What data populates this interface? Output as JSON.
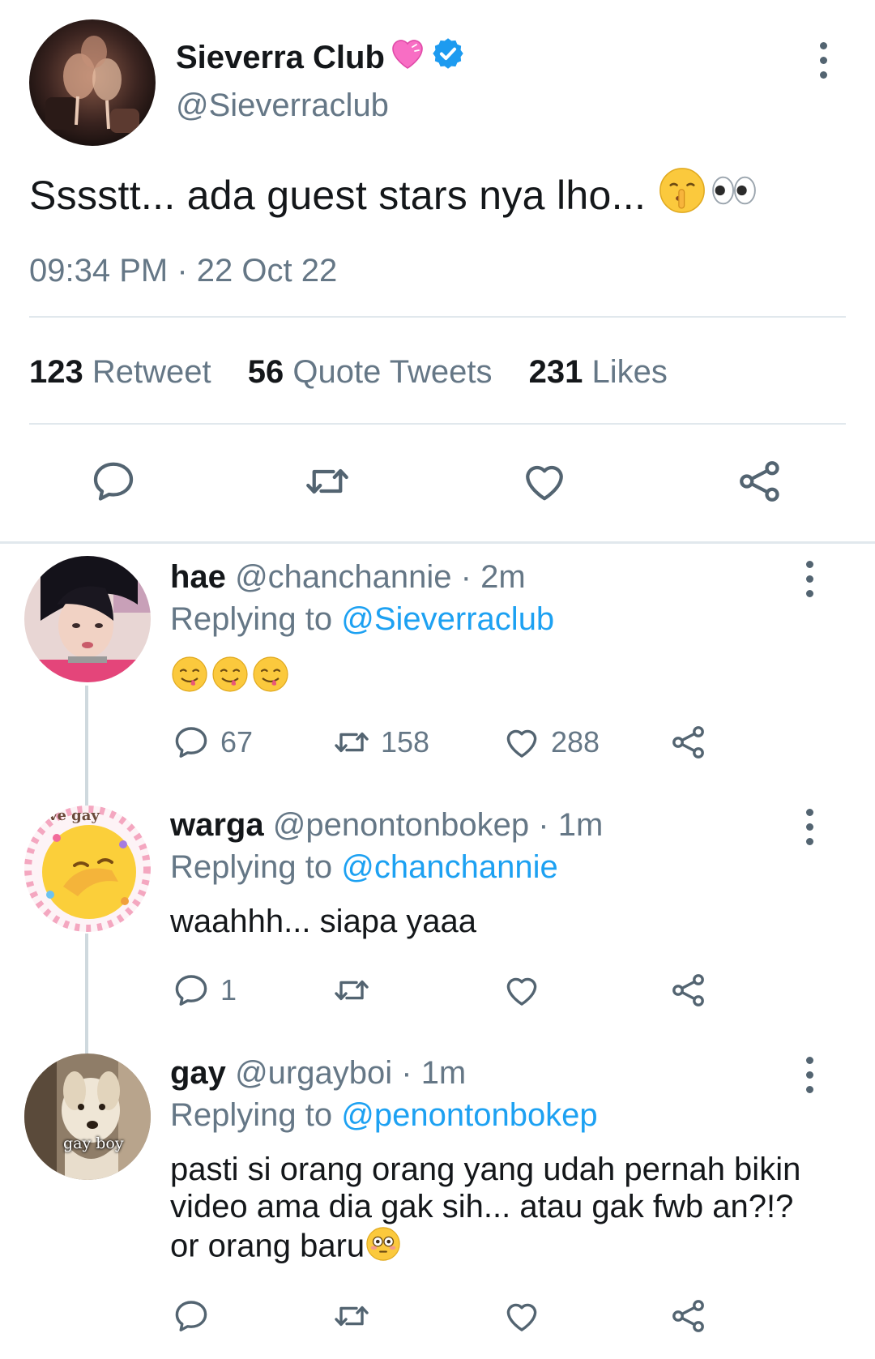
{
  "main_tweet": {
    "name": "Sieverra Club",
    "handle": "@Sieverraclub",
    "text": "Sssstt... ada guest stars nya lho...",
    "time": "09:34 PM",
    "date_sep": "·",
    "date": "22 Oct 22",
    "stats": [
      {
        "count": "123",
        "label": "Retweet"
      },
      {
        "count": "56",
        "label": "Quote Tweets"
      },
      {
        "count": "231",
        "label": "Likes"
      }
    ],
    "actions": [
      "reply-icon",
      "retweet-icon",
      "like-icon",
      "share-icon"
    ]
  },
  "replies": [
    {
      "name": "hae",
      "handle": "@chanchannie",
      "sep": "·",
      "time": "2m",
      "replying_label": "Replying to",
      "replying_to": "@Sieverraclub",
      "text": "",
      "counts": {
        "reply": "67",
        "retweet": "158",
        "like": "288"
      }
    },
    {
      "name": "warga",
      "handle": "@penontonbokep",
      "sep": "·",
      "time": "1m",
      "replying_label": "Replying to",
      "replying_to": "@chanchannie",
      "text": "waahhh... siapa yaaa",
      "avatar_text": "ve gay",
      "counts": {
        "reply": "1",
        "retweet": "",
        "like": ""
      }
    },
    {
      "name": "gay",
      "handle": "@urgayboi",
      "sep": "·",
      "time": "1m",
      "replying_label": "Replying to",
      "replying_to": "@penontonbokep",
      "text": "pasti si orang orang yang udah pernah bikin video ama dia gak sih... atau gak fwb an?!? or orang baru",
      "avatar_text": "gay boy",
      "counts": {
        "reply": "",
        "retweet": "",
        "like": ""
      }
    }
  ],
  "colors": {
    "accent": "#1da1f2",
    "muted": "#657786",
    "text": "#14171a",
    "divider": "#e1e8ed",
    "verified": "#1d9bf0"
  }
}
